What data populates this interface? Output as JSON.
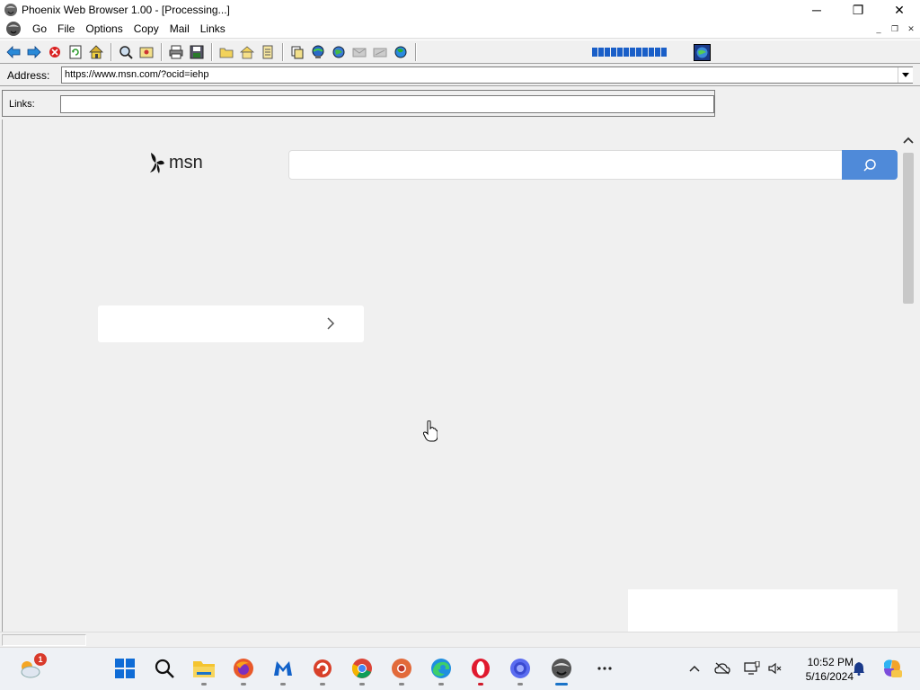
{
  "window": {
    "title": "Phoenix Web Browser 1.00 - [Processing...]",
    "minimize": "─",
    "maximize": "❐",
    "close": "✕"
  },
  "menu": {
    "items": [
      "Go",
      "File",
      "Options",
      "Copy",
      "Mail",
      "Links"
    ],
    "mdi_minimize": "_",
    "mdi_restore": "❐",
    "mdi_close": "✕"
  },
  "toolbar": {
    "buttons": [
      "back-icon",
      "forward-icon",
      "stop-icon",
      "refresh-icon",
      "home-icon",
      "find-icon",
      "open-icon",
      "print-icon",
      "save-icon",
      "favorites-folder-icon",
      "home-folder-icon",
      "history-icon",
      "copy-icon",
      "network-icon",
      "globe-icon",
      "mail-icon",
      "send-icon",
      "world-icon"
    ],
    "progress_segments": 12
  },
  "address": {
    "label": "Address:",
    "value": "https://www.msn.com/?ocid=iehp"
  },
  "links": {
    "label": "Links:",
    "value": ""
  },
  "page": {
    "logo_text": "msn",
    "search_placeholder": ""
  },
  "taskbar": {
    "weather_badge": "1",
    "apps": [
      "weather-icon",
      "start-icon",
      "search-icon",
      "file-explorer-icon",
      "firefox-icon",
      "malwarebytes-icon",
      "ccleaner-icon",
      "chrome-icon",
      "chromium-icon",
      "edge-icon",
      "opera-icon",
      "browser-icon",
      "phoenix-browser-icon",
      "more-icon"
    ],
    "time": "10:52 PM",
    "date": "5/16/2024"
  }
}
